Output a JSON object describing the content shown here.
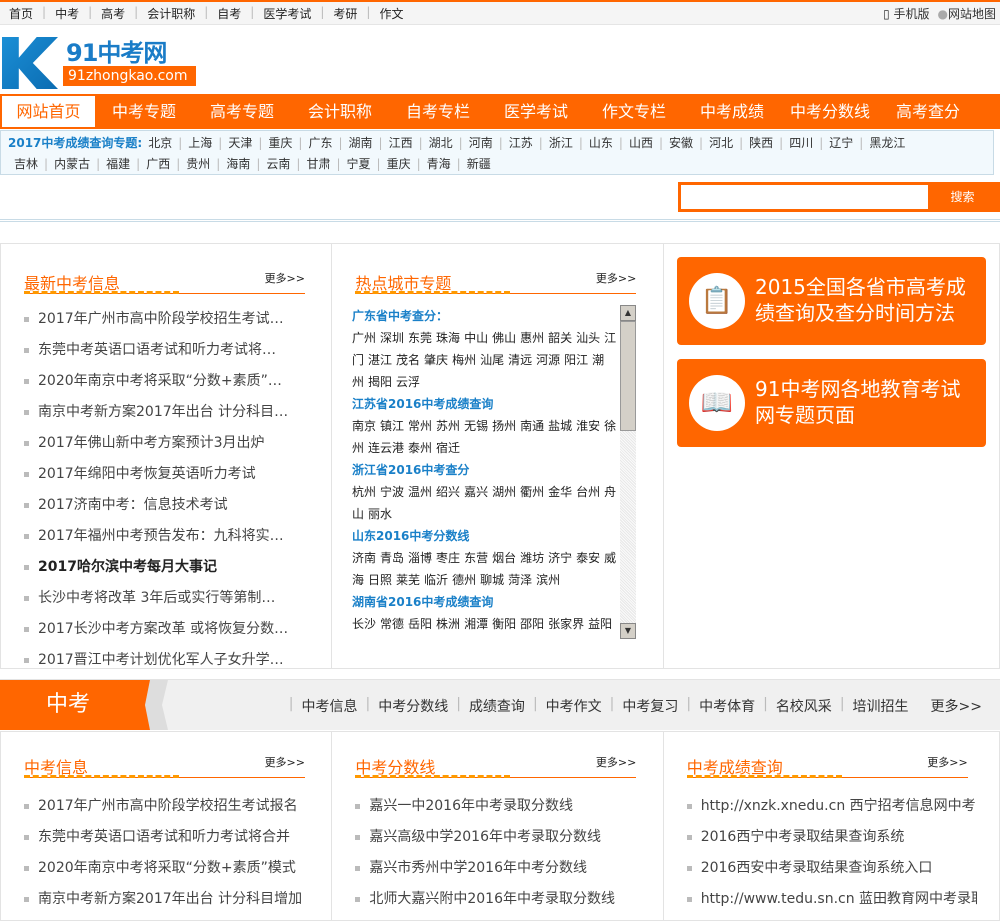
{
  "topbar": {
    "links": [
      "首页",
      "中考",
      "高考",
      "会计职称",
      "自考",
      "医学考试",
      "考研",
      "作文"
    ],
    "mobile": "手机版",
    "sitemap": "网站地图"
  },
  "logo": {
    "title": "91中考网",
    "domain": "91zhongkao.com"
  },
  "nav": [
    "网站首页",
    "中考专题",
    "高考专题",
    "会计职称",
    "自考专栏",
    "医学考试",
    "作文专栏",
    "中考成绩",
    "中考分数线",
    "高考查分"
  ],
  "provinces": {
    "label": "2017中考成绩查询专题:",
    "items": [
      "北京",
      "上海",
      "天津",
      "重庆",
      "广东",
      "湖南",
      "江西",
      "湖北",
      "河南",
      "江苏",
      "浙江",
      "山东",
      "山西",
      "安徽",
      "河北",
      "陕西",
      "四川",
      "辽宁",
      "黑龙江",
      "吉林",
      "内蒙古",
      "福建",
      "广西",
      "贵州",
      "海南",
      "云南",
      "甘肃",
      "宁夏",
      "重庆",
      "青海",
      "新疆"
    ]
  },
  "search": {
    "button": "搜索",
    "value": ""
  },
  "latest": {
    "title": "最新中考信息",
    "more": "更多>>",
    "items": [
      "2017年广州市高中阶段学校招生考试…",
      "东莞中考英语口语考试和听力考试将…",
      "2020年南京中考将采取“分数+素质”…",
      "南京中考新方案2017年出台 计分科目…",
      "2017年佛山新中考方案预计3月出炉",
      "2017年绵阳中考恢复英语听力考试",
      "2017济南中考：信息技术考试",
      "2017年福州中考预告发布：九科将实…",
      "2017哈尔滨中考每月大事记",
      "长沙中考将改革 3年后或实行等第制…",
      "2017长沙中考方案改革 或将恢复分数…",
      "2017晋江中考计划优化军人子女升学…"
    ]
  },
  "hot": {
    "title": "热点城市专题",
    "more": "更多>>",
    "groups": [
      {
        "title": "广东省中考查分：",
        "cities": [
          "广州",
          "深圳",
          "东莞",
          "珠海",
          "中山",
          "佛山",
          "惠州",
          "韶关",
          "汕头",
          "江门",
          "湛江",
          "茂名",
          "肇庆",
          "梅州",
          "汕尾",
          "清远",
          "河源",
          "阳江",
          "潮州",
          "揭阳",
          "云浮"
        ]
      },
      {
        "title": "江苏省2016中考成绩查询",
        "cities": [
          "南京",
          "镇江",
          "常州",
          "苏州",
          "无锡",
          "扬州",
          "南通",
          "盐城",
          "淮安",
          "徐州",
          "连云港",
          "泰州",
          "宿迁"
        ]
      },
      {
        "title": "浙江省2016中考查分",
        "cities": [
          "杭州",
          "宁波",
          "温州",
          "绍兴",
          "嘉兴",
          "湖州",
          "衢州",
          "金华",
          "台州",
          "舟山",
          "丽水"
        ]
      },
      {
        "title": "山东2016中考分数线",
        "cities": [
          "济南",
          "青岛",
          "淄博",
          "枣庄",
          "东营",
          "烟台",
          "潍坊",
          "济宁",
          "泰安",
          "威海",
          "日照",
          "莱芜",
          "临沂",
          "德州",
          "聊城",
          "菏泽",
          "滨州"
        ]
      },
      {
        "title": "湖南省2016中考成绩查询",
        "cities": [
          "长沙",
          "常德",
          "岳阳",
          "株洲",
          "湘潭",
          "衡阳",
          "邵阳",
          "张家界",
          "益阳"
        ]
      }
    ]
  },
  "promos": [
    "2015全国各省市高考成绩查询及查分时间方法",
    "91中考网各地教育考试网专题页面"
  ],
  "section": {
    "label": "中考",
    "links": [
      "中考信息",
      "中考分数线",
      "成绩查询",
      "中考作文",
      "中考复习",
      "中考体育",
      "名校风采",
      "培训招生"
    ],
    "more": "更多>>"
  },
  "bottom": [
    {
      "title": "中考信息",
      "more": "更多>>",
      "items": [
        "2017年广州市高中阶段学校招生考试报名",
        "东莞中考英语口语考试和听力考试将合并",
        "2020年南京中考将采取“分数+素质”模式",
        "南京中考新方案2017年出台 计分科目增加"
      ]
    },
    {
      "title": "中考分数线",
      "more": "更多>>",
      "items": [
        "嘉兴一中2016年中考录取分数线",
        "嘉兴高级中学2016年中考录取分数线",
        "嘉兴市秀州中学2016年中考分数线",
        "北师大嘉兴附中2016年中考录取分数线"
      ]
    },
    {
      "title": "中考成绩查询",
      "more": "更多>>",
      "items": [
        "http://xnzk.xnedu.cn 西宁招考信息网中考",
        "2016西宁中考录取结果查询系统",
        "2016西安中考录取结果查询系统入口",
        "http://www.tedu.sn.cn 蓝田教育网中考录取"
      ]
    }
  ]
}
